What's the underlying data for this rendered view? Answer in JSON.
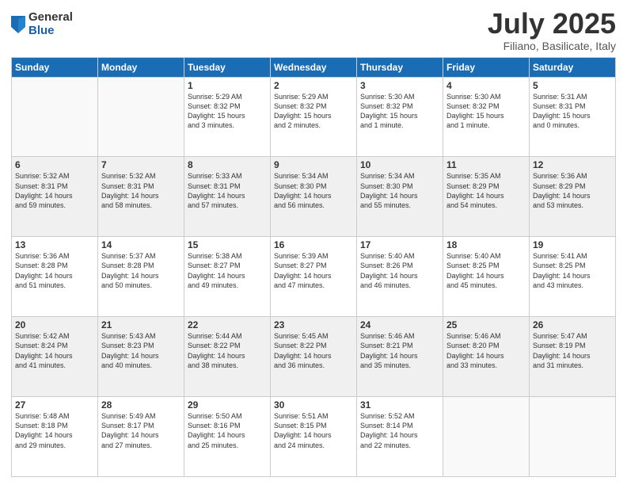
{
  "logo": {
    "general": "General",
    "blue": "Blue"
  },
  "header": {
    "month": "July 2025",
    "location": "Filiano, Basilicate, Italy"
  },
  "weekdays": [
    "Sunday",
    "Monday",
    "Tuesday",
    "Wednesday",
    "Thursday",
    "Friday",
    "Saturday"
  ],
  "weeks": [
    [
      {
        "day": "",
        "info": ""
      },
      {
        "day": "",
        "info": ""
      },
      {
        "day": "1",
        "info": "Sunrise: 5:29 AM\nSunset: 8:32 PM\nDaylight: 15 hours\nand 3 minutes."
      },
      {
        "day": "2",
        "info": "Sunrise: 5:29 AM\nSunset: 8:32 PM\nDaylight: 15 hours\nand 2 minutes."
      },
      {
        "day": "3",
        "info": "Sunrise: 5:30 AM\nSunset: 8:32 PM\nDaylight: 15 hours\nand 1 minute."
      },
      {
        "day": "4",
        "info": "Sunrise: 5:30 AM\nSunset: 8:32 PM\nDaylight: 15 hours\nand 1 minute."
      },
      {
        "day": "5",
        "info": "Sunrise: 5:31 AM\nSunset: 8:31 PM\nDaylight: 15 hours\nand 0 minutes."
      }
    ],
    [
      {
        "day": "6",
        "info": "Sunrise: 5:32 AM\nSunset: 8:31 PM\nDaylight: 14 hours\nand 59 minutes."
      },
      {
        "day": "7",
        "info": "Sunrise: 5:32 AM\nSunset: 8:31 PM\nDaylight: 14 hours\nand 58 minutes."
      },
      {
        "day": "8",
        "info": "Sunrise: 5:33 AM\nSunset: 8:31 PM\nDaylight: 14 hours\nand 57 minutes."
      },
      {
        "day": "9",
        "info": "Sunrise: 5:34 AM\nSunset: 8:30 PM\nDaylight: 14 hours\nand 56 minutes."
      },
      {
        "day": "10",
        "info": "Sunrise: 5:34 AM\nSunset: 8:30 PM\nDaylight: 14 hours\nand 55 minutes."
      },
      {
        "day": "11",
        "info": "Sunrise: 5:35 AM\nSunset: 8:29 PM\nDaylight: 14 hours\nand 54 minutes."
      },
      {
        "day": "12",
        "info": "Sunrise: 5:36 AM\nSunset: 8:29 PM\nDaylight: 14 hours\nand 53 minutes."
      }
    ],
    [
      {
        "day": "13",
        "info": "Sunrise: 5:36 AM\nSunset: 8:28 PM\nDaylight: 14 hours\nand 51 minutes."
      },
      {
        "day": "14",
        "info": "Sunrise: 5:37 AM\nSunset: 8:28 PM\nDaylight: 14 hours\nand 50 minutes."
      },
      {
        "day": "15",
        "info": "Sunrise: 5:38 AM\nSunset: 8:27 PM\nDaylight: 14 hours\nand 49 minutes."
      },
      {
        "day": "16",
        "info": "Sunrise: 5:39 AM\nSunset: 8:27 PM\nDaylight: 14 hours\nand 47 minutes."
      },
      {
        "day": "17",
        "info": "Sunrise: 5:40 AM\nSunset: 8:26 PM\nDaylight: 14 hours\nand 46 minutes."
      },
      {
        "day": "18",
        "info": "Sunrise: 5:40 AM\nSunset: 8:25 PM\nDaylight: 14 hours\nand 45 minutes."
      },
      {
        "day": "19",
        "info": "Sunrise: 5:41 AM\nSunset: 8:25 PM\nDaylight: 14 hours\nand 43 minutes."
      }
    ],
    [
      {
        "day": "20",
        "info": "Sunrise: 5:42 AM\nSunset: 8:24 PM\nDaylight: 14 hours\nand 41 minutes."
      },
      {
        "day": "21",
        "info": "Sunrise: 5:43 AM\nSunset: 8:23 PM\nDaylight: 14 hours\nand 40 minutes."
      },
      {
        "day": "22",
        "info": "Sunrise: 5:44 AM\nSunset: 8:22 PM\nDaylight: 14 hours\nand 38 minutes."
      },
      {
        "day": "23",
        "info": "Sunrise: 5:45 AM\nSunset: 8:22 PM\nDaylight: 14 hours\nand 36 minutes."
      },
      {
        "day": "24",
        "info": "Sunrise: 5:46 AM\nSunset: 8:21 PM\nDaylight: 14 hours\nand 35 minutes."
      },
      {
        "day": "25",
        "info": "Sunrise: 5:46 AM\nSunset: 8:20 PM\nDaylight: 14 hours\nand 33 minutes."
      },
      {
        "day": "26",
        "info": "Sunrise: 5:47 AM\nSunset: 8:19 PM\nDaylight: 14 hours\nand 31 minutes."
      }
    ],
    [
      {
        "day": "27",
        "info": "Sunrise: 5:48 AM\nSunset: 8:18 PM\nDaylight: 14 hours\nand 29 minutes."
      },
      {
        "day": "28",
        "info": "Sunrise: 5:49 AM\nSunset: 8:17 PM\nDaylight: 14 hours\nand 27 minutes."
      },
      {
        "day": "29",
        "info": "Sunrise: 5:50 AM\nSunset: 8:16 PM\nDaylight: 14 hours\nand 25 minutes."
      },
      {
        "day": "30",
        "info": "Sunrise: 5:51 AM\nSunset: 8:15 PM\nDaylight: 14 hours\nand 24 minutes."
      },
      {
        "day": "31",
        "info": "Sunrise: 5:52 AM\nSunset: 8:14 PM\nDaylight: 14 hours\nand 22 minutes."
      },
      {
        "day": "",
        "info": ""
      },
      {
        "day": "",
        "info": ""
      }
    ]
  ]
}
